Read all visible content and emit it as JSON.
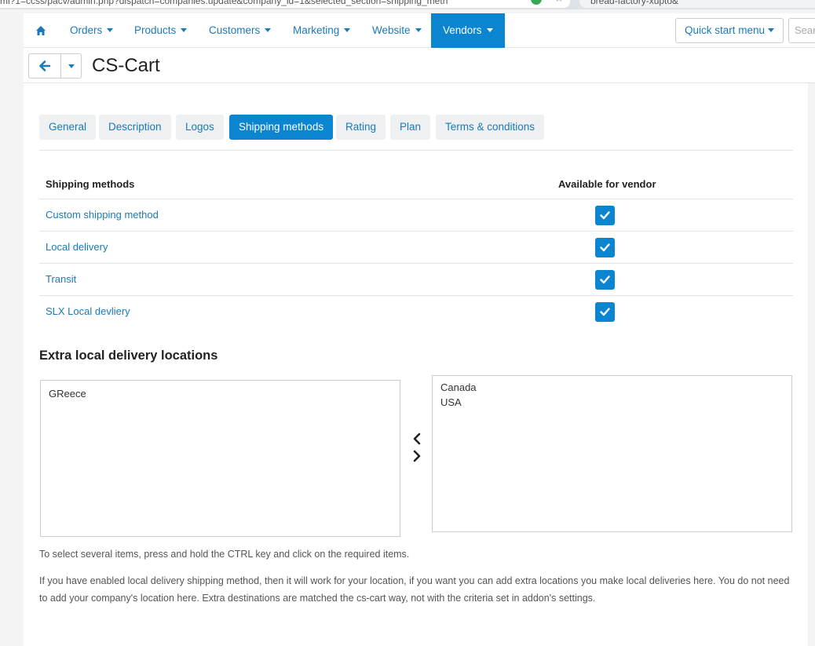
{
  "browser": {
    "url_fragment": "ml?1=ccss/pacv/admin.php?dispatch=companies.update&company_id=1&selected_section=shipping_meth",
    "search_tab": "bread-factory-xupto&"
  },
  "navbar": {
    "items": [
      {
        "label": "Orders"
      },
      {
        "label": "Products"
      },
      {
        "label": "Customers"
      },
      {
        "label": "Marketing"
      },
      {
        "label": "Website"
      },
      {
        "label": "Vendors"
      }
    ],
    "quick_start": "Quick start menu",
    "search_placeholder": "Search"
  },
  "titlebar": {
    "title": "CS-Cart"
  },
  "tabs": [
    {
      "label": "General"
    },
    {
      "label": "Description"
    },
    {
      "label": "Logos"
    },
    {
      "label": "Shipping methods",
      "active": true
    },
    {
      "label": "Rating"
    },
    {
      "label": "Plan"
    },
    {
      "label": "Terms & conditions"
    }
  ],
  "shipping_table": {
    "col_name": "Shipping methods",
    "col_available": "Available for vendor",
    "rows": [
      {
        "name": "Custom shipping method",
        "available": true
      },
      {
        "name": "Local delivery",
        "available": true
      },
      {
        "name": "Transit",
        "available": true
      },
      {
        "name": "SLX Local devliery",
        "available": true
      }
    ]
  },
  "extra_locations": {
    "title": "Extra local delivery locations",
    "available": [
      "GReece"
    ],
    "selected": [
      "Canada",
      "USA"
    ]
  },
  "help": {
    "select_hint": "To select several items, press and hold the CTRL key and click on the required items.",
    "info": "If you have enabled local delivery shipping method, then it will work for your location, if you want you can add extra locations you make local deliveries here. You do not need to add your company's location here. Extra destinations are matched the cs-cart way, not with the criteria set in addon's settings."
  },
  "colors": {
    "accent": "#0b85cf",
    "link": "#1a7ab8",
    "tab_bg": "#eef0f2"
  }
}
